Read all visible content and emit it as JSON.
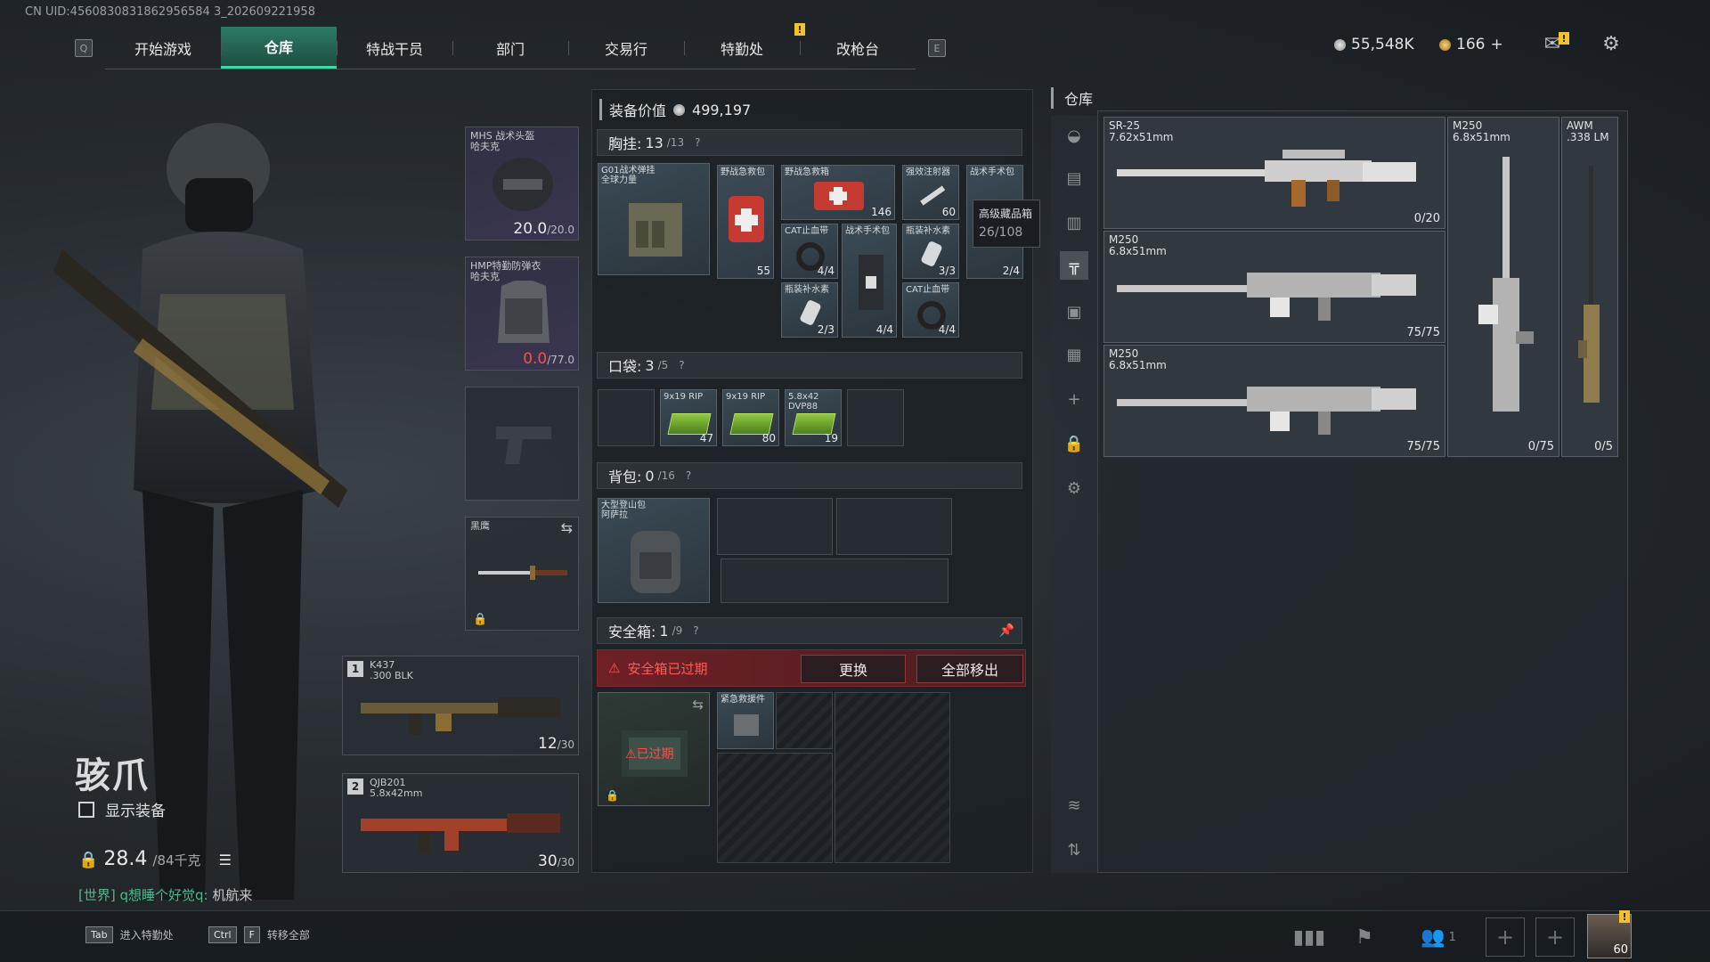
{
  "uid": "CN UID:4560830831862956584 3_202609221958",
  "nav": {
    "left_key": "Q",
    "right_key": "E",
    "tabs": [
      "开始游戏",
      "仓库",
      "特战干员",
      "部门",
      "交易行",
      "特勤处",
      "改枪台"
    ],
    "active": 1,
    "notice": "!"
  },
  "currency": {
    "silver": "55,548K",
    "gold": "166",
    "plus": "+"
  },
  "character": {
    "name": "骇爪",
    "show_equipment": "显示装备",
    "weight": "28.4",
    "weight_max": "/84千克"
  },
  "chat": {
    "channel": "[世界]",
    "user": "q想睡个好觉q:",
    "message": "机航来"
  },
  "equipment": {
    "helmet": {
      "name": "MHS 战术头盔",
      "sub": "哈夫克",
      "dur": "20.0",
      "max": "/20.0"
    },
    "armor": {
      "name": "HMP特勤防弹衣",
      "sub": "哈夫克",
      "dur": "0.0",
      "max": "/77.0"
    },
    "melee": {
      "name": "黑鹰"
    },
    "primary": {
      "num": "1",
      "name": "K437",
      ".cal": "",
      "cal": ".300 BLK",
      "ammo": "12",
      "ammo_max": "/30"
    },
    "secondary": {
      "num": "2",
      "name": "QJB201",
      "cal": "5.8x42mm",
      "ammo": "30",
      "ammo_max": "/30"
    }
  },
  "mid": {
    "value_label": "装备价值",
    "value": "499,197",
    "chest": {
      "label": "胸挂:",
      "count": "13",
      "max": "/13"
    },
    "pocket": {
      "label": "口袋:",
      "count": "3",
      "max": "/5"
    },
    "backpack": {
      "label": "背包:",
      "count": "0",
      "max": "/16"
    },
    "safe": {
      "label": "安全箱:",
      "count": "1",
      "max": "/9",
      "expired": "安全箱已过期",
      "replace": "更换",
      "move_all": "全部移出",
      "expired_tag": "已过期"
    },
    "chest_rig": {
      "name": "G01战术弹挂",
      "sub": "全球力量"
    },
    "items": [
      {
        "name": "野战急救包",
        "count": "55"
      },
      {
        "name": "野战急救箱",
        "count": "146"
      },
      {
        "name": "强效注射器",
        "count": "60"
      },
      {
        "name": "战术手术包",
        "count": "2/4"
      },
      {
        "name": "CAT止血带",
        "count": "4/4"
      },
      {
        "name": "战术手术包",
        "count": "4/4"
      },
      {
        "name": "瓶装补水素",
        "count": "3/3"
      },
      {
        "name": "瓶装补水素",
        "count": "2/3"
      },
      {
        "name": "CAT止血带",
        "count": "4/4"
      }
    ],
    "pocket_items": [
      {
        "name": "9x19 RIP",
        "count": "47"
      },
      {
        "name": "9x19 RIP",
        "count": "80"
      },
      {
        "name": "5.8x42 DVP88",
        "count": "19"
      }
    ],
    "backpack_item": {
      "name": "大型登山包",
      "sub": "阿萨拉"
    },
    "safe_item": {
      "name": "紧急救援件"
    }
  },
  "tooltip": {
    "title": "高级藏品箱",
    "value": "26/108"
  },
  "storage": {
    "title": "仓库",
    "guns": [
      {
        "name": "SR-25",
        "cal": "7.62x51mm",
        "count": "0/20"
      },
      {
        "name": "M250",
        "cal": "6.8x51mm",
        "count": "75/75"
      },
      {
        "name": "M250",
        "cal": "6.8x51mm",
        "count": "75/75"
      },
      {
        "name": "M250",
        "cal": "6.8x51mm",
        "count": "0/75"
      },
      {
        "name": "AWM",
        "cal": ".338 LM",
        "count": "0/5"
      }
    ]
  },
  "bottom": {
    "tab_key": "Tab",
    "tab_label": "进入特勤处",
    "ctrl_key": "Ctrl",
    "f_key": "F",
    "transfer_label": "转移全部",
    "friends": "1",
    "level": "60"
  }
}
